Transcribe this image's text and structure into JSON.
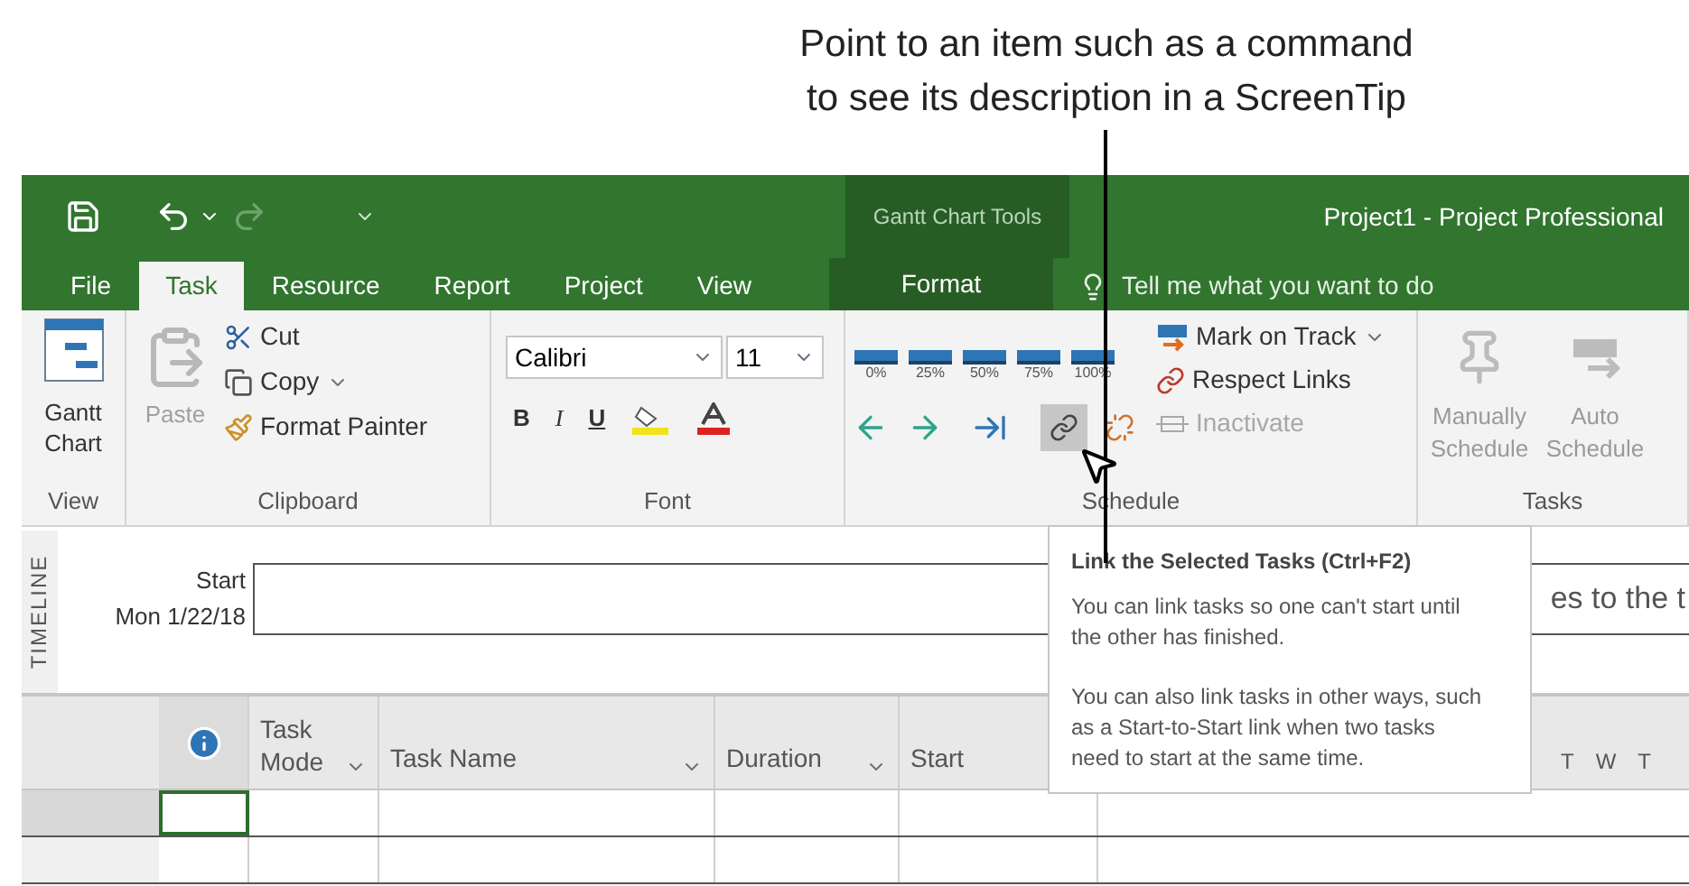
{
  "callout": {
    "lines": [
      "Point to an item such as a command",
      "to see its description in a ScreenTip"
    ]
  },
  "title_bar": {
    "context_label": "Gantt Chart Tools",
    "title": "Project1 - Project Professional"
  },
  "tabs": [
    {
      "label": "File",
      "selected": false,
      "kind": "normal"
    },
    {
      "label": "Task",
      "selected": true,
      "kind": "normal"
    },
    {
      "label": "Resource",
      "selected": false,
      "kind": "normal"
    },
    {
      "label": "Report",
      "selected": false,
      "kind": "normal"
    },
    {
      "label": "Project",
      "selected": false,
      "kind": "normal"
    },
    {
      "label": "View",
      "selected": false,
      "kind": "normal"
    },
    {
      "label": "Format",
      "selected": false,
      "kind": "contextual"
    }
  ],
  "tell_me": {
    "placeholder": "Tell me what you want to do"
  },
  "ribbon": {
    "view": {
      "label": "View",
      "button": "Gantt Chart"
    },
    "clipboard": {
      "label": "Clipboard",
      "paste": {
        "label": "Paste",
        "disabled": true
      },
      "cut": "Cut",
      "copy": "Copy",
      "format_painter": "Format Painter"
    },
    "font": {
      "label": "Font",
      "font_name": "Calibri",
      "font_size": "11",
      "bold": "B",
      "italic": "I",
      "underline": "U"
    },
    "schedule": {
      "label": "Schedule",
      "percent_buttons": [
        "0%",
        "25%",
        "50%",
        "75%",
        "100%"
      ],
      "mark_on_track": "Mark on Track",
      "respect_links": "Respect Links",
      "inactivate": {
        "label": "Inactivate",
        "disabled": true
      },
      "link_button": {
        "highlighted": true
      }
    },
    "tasks": {
      "label": "Tasks",
      "manually": {
        "label": "Manually Schedule",
        "disabled": true
      },
      "auto": {
        "label": "Auto Schedule",
        "disabled": true
      }
    }
  },
  "timeline": {
    "side_label": "TIMELINE",
    "start_label": "Start",
    "start_date": "Mon 1/22/18",
    "hint": "es to the t"
  },
  "table": {
    "columns": [
      "Task Mode",
      "Task Name",
      "Duration",
      "Start"
    ],
    "timescale": [
      "T",
      "W",
      "T"
    ],
    "rows": [
      {
        "selected": true
      },
      {
        "selected": false
      }
    ]
  },
  "screentip": {
    "title": "Link the Selected Tasks (Ctrl+F2)",
    "paragraphs": [
      "You can link tasks so one can't start until the other has finished.",
      "You can also link tasks in other ways, such as a Start-to-Start link when two tasks need to start at the same time."
    ]
  }
}
